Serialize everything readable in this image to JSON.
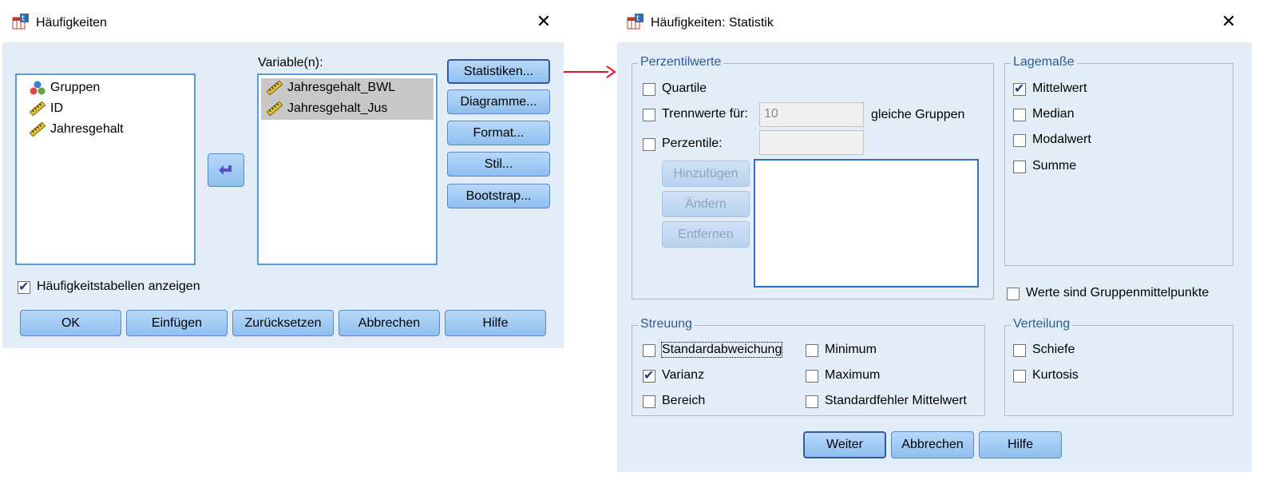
{
  "left_dialog": {
    "title": "Häufigkeiten",
    "source_list": [
      {
        "label": "Gruppen",
        "icon": "nominal-variable-icon"
      },
      {
        "label": "ID",
        "icon": "scale-variable-icon"
      },
      {
        "label": "Jahresgehalt",
        "icon": "scale-variable-icon"
      }
    ],
    "variables_label": "Variable(n):",
    "target_list": [
      {
        "label": "Jahresgehalt_BWL",
        "icon": "scale-variable-icon",
        "selected": true
      },
      {
        "label": "Jahresgehalt_Jus",
        "icon": "scale-variable-icon",
        "selected": true
      }
    ],
    "side_buttons": [
      "Statistiken...",
      "Diagramme...",
      "Format...",
      "Stil...",
      "Bootstrap..."
    ],
    "show_tables": {
      "label": "Häufigkeitstabellen anzeigen",
      "checked": true
    },
    "bottom_buttons": [
      "OK",
      "Einfügen",
      "Zurücksetzen",
      "Abbrechen",
      "Hilfe"
    ]
  },
  "arrow_color": "#e8141c",
  "right_dialog": {
    "title": "Häufigkeiten: Statistik",
    "perzentilwerte": {
      "caption": "Perzentilwerte",
      "quartile": {
        "label": "Quartile",
        "checked": false
      },
      "trennwerte": {
        "label": "Trennwerte für:",
        "checked": false,
        "value": "10",
        "suffix": "gleiche Gruppen"
      },
      "perzentile": {
        "label": "Perzentile:",
        "checked": false,
        "value": ""
      },
      "buttons": [
        "Hinzufügen",
        "Ändern",
        "Entfernen"
      ]
    },
    "lagemasse": {
      "caption": "Lagemaße",
      "items": [
        {
          "label": "Mittelwert",
          "checked": true
        },
        {
          "label": "Median",
          "checked": false
        },
        {
          "label": "Modalwert",
          "checked": false
        },
        {
          "label": "Summe",
          "checked": false
        }
      ]
    },
    "gruppenmittelpunkte": {
      "label": "Werte sind Gruppenmittelpunkte",
      "checked": false
    },
    "streuung": {
      "caption": "Streuung",
      "items": [
        {
          "label": "Standardabweichung",
          "checked": false
        },
        {
          "label": "Varianz",
          "checked": true
        },
        {
          "label": "Bereich",
          "checked": false
        },
        {
          "label": "Minimum",
          "checked": false
        },
        {
          "label": "Maximum",
          "checked": false
        },
        {
          "label": "Standardfehler Mittelwert",
          "checked": false
        }
      ]
    },
    "verteilung": {
      "caption": "Verteilung",
      "items": [
        {
          "label": "Schiefe",
          "checked": false
        },
        {
          "label": "Kurtosis",
          "checked": false
        }
      ]
    },
    "buttons": [
      "Weiter",
      "Abbrechen",
      "Hilfe"
    ]
  }
}
